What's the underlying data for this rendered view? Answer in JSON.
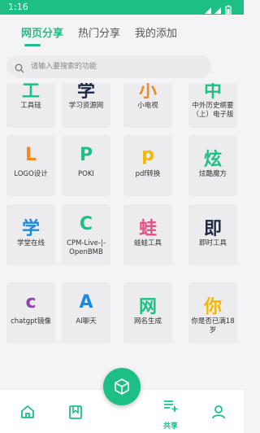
{
  "status": {
    "time": "1:16"
  },
  "tabs": [
    {
      "label": "网页分享"
    },
    {
      "label": "热门分享"
    },
    {
      "label": "我的添加"
    }
  ],
  "search": {
    "placeholder": "请输入要搜索的功能"
  },
  "cards": [
    {
      "glyph": "工",
      "label": "工具硅",
      "color": "#1dbf85"
    },
    {
      "glyph": "学",
      "label": "学习资源网",
      "color": "#1f2a44"
    },
    {
      "glyph": "小",
      "label": "小电视",
      "color": "#f08a24"
    },
    {
      "glyph": "中",
      "label": "中外历史纲要（上）电子版",
      "color": "#1dbf85"
    },
    {
      "glyph": "L",
      "label": "LOGO设计",
      "color": "#f08a24"
    },
    {
      "glyph": "P",
      "label": "POKI",
      "color": "#1dbf85"
    },
    {
      "glyph": "p",
      "label": "pdf转换",
      "color": "#f5b800"
    },
    {
      "glyph": "炫",
      "label": "炫酷魔方",
      "color": "#1dbf85"
    },
    {
      "glyph": "学",
      "label": "学堂在线",
      "color": "#1e88e5"
    },
    {
      "glyph": "C",
      "label": "CPM-Live-|-OpenBMB",
      "color": "#1dbf85"
    },
    {
      "glyph": "蛙",
      "label": "蛙蛙工具",
      "color": "#e8508a"
    },
    {
      "glyph": "即",
      "label": "即时工具",
      "color": "#1f2a44"
    },
    {
      "glyph": "c",
      "label": "chatgpt镜像",
      "color": "#8e44ad"
    },
    {
      "glyph": "A",
      "label": "AI聊天",
      "color": "#1e88e5"
    },
    {
      "glyph": "网",
      "label": "网名生成",
      "color": "#1dbf85"
    },
    {
      "glyph": "你",
      "label": "你是否已满18岁",
      "color": "#f5b800"
    }
  ],
  "bottom_nav": {
    "share_label": "共享",
    "icons": [
      "home-icon",
      "bookmark-icon",
      "playlist-add-icon",
      "person-icon"
    ],
    "fab_icon": "cube-icon"
  },
  "colors": {
    "accent": "#1dbf85"
  }
}
